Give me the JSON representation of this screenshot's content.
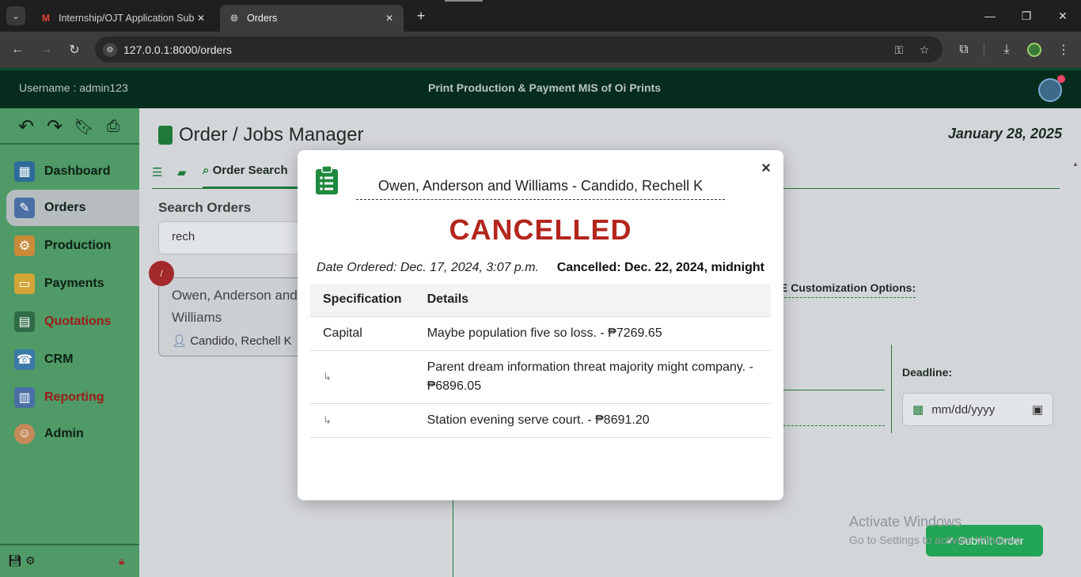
{
  "browser": {
    "tabs": [
      {
        "title": "Internship/OJT Application Subi",
        "favicon": "gmail-icon",
        "active": false
      },
      {
        "title": "Orders",
        "favicon": "globe-icon",
        "active": true
      }
    ],
    "url": "127.0.0.1:8000/orders"
  },
  "header": {
    "username": "Username : admin123",
    "app_title": "Print Production & Payment MIS of Oi Prints"
  },
  "sidebar": {
    "items": [
      {
        "label": "Dashboard",
        "icon": "dashboard-icon",
        "active": false,
        "color": "#0e1f15"
      },
      {
        "label": "Orders",
        "icon": "orders-icon",
        "active": true,
        "color": "#0e1f15"
      },
      {
        "label": "Production",
        "icon": "production-icon",
        "active": false,
        "color": "#0e1f15"
      },
      {
        "label": "Payments",
        "icon": "payments-icon",
        "active": false,
        "color": "#0e1f15"
      },
      {
        "label": "Quotations",
        "icon": "quotations-icon",
        "active": false,
        "color": "#9b1c1c"
      },
      {
        "label": "CRM",
        "icon": "crm-icon",
        "active": false,
        "color": "#0e1f15"
      },
      {
        "label": "Reporting",
        "icon": "reporting-icon",
        "active": false,
        "color": "#9b1c1c"
      },
      {
        "label": "Admin",
        "icon": "admin-icon",
        "active": false,
        "color": "#0e1f15"
      }
    ]
  },
  "main": {
    "page_title": "Order / Jobs Manager",
    "date": "January 28, 2025",
    "subtab_active": "Order Search",
    "search_label": "Search Orders",
    "search_value": "rech",
    "badge": "/",
    "order_card": {
      "company": "Owen, Anderson and Williams",
      "client": "Candido, Rechell K"
    },
    "customization_label": "E Customization Options:",
    "deadline_label": "Deadline:",
    "deadline_placeholder": "mm/dd/yyyy",
    "submit_label": "Submit Order",
    "watermark_line1": "Activate Windows",
    "watermark_line2": "Go to Settings to activate Windows."
  },
  "modal": {
    "heading": "Owen, Anderson and Williams - Candido, Rechell K",
    "status": "CANCELLED",
    "status_color": "#b3261e",
    "date_ordered": "Date Ordered: Dec. 17, 2024, 3:07 p.m.",
    "cancelled": "Cancelled: Dec. 22, 2024, midnight",
    "table": {
      "headers": [
        "Specification",
        "Details"
      ],
      "rows": [
        {
          "spec": "Capital",
          "details": "Maybe population five so loss. - ₱7269.65"
        },
        {
          "spec": "↳",
          "details": "Parent dream information threat majority might company. - ₱6896.05"
        },
        {
          "spec": "↳",
          "details": "Station evening serve court. - ₱8691.20"
        }
      ]
    }
  }
}
